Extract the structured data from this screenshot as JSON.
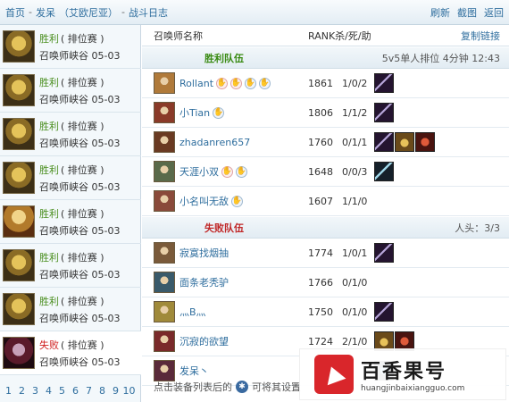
{
  "breadcrumb": {
    "home": "首页",
    "user": "发呆",
    "server": "（艾欧尼亚）",
    "page": "战斗日志"
  },
  "actions": {
    "refresh": "刷新",
    "screenshot": "截图",
    "back": "返回"
  },
  "matches": [
    {
      "result": "胜利",
      "mode": "( 排位赛 )",
      "map": "召唤师峡谷",
      "date": "05-03",
      "avatar": "a"
    },
    {
      "result": "胜利",
      "mode": "( 排位赛 )",
      "map": "召唤师峡谷",
      "date": "05-03",
      "avatar": "a"
    },
    {
      "result": "胜利",
      "mode": "( 排位赛 )",
      "map": "召唤师峡谷",
      "date": "05-03",
      "avatar": "a"
    },
    {
      "result": "胜利",
      "mode": "( 排位赛 )",
      "map": "召唤师峡谷",
      "date": "05-03",
      "avatar": "a"
    },
    {
      "result": "胜利",
      "mode": "( 排位赛 )",
      "map": "召唤师峡谷",
      "date": "05-03",
      "avatar": "alt"
    },
    {
      "result": "胜利",
      "mode": "( 排位赛 )",
      "map": "召唤师峡谷",
      "date": "05-03",
      "avatar": "a"
    },
    {
      "result": "胜利",
      "mode": "( 排位赛 )",
      "map": "召唤师峡谷",
      "date": "05-03",
      "avatar": "a"
    },
    {
      "result": "失败",
      "mode": "( 排位赛 )",
      "map": "召唤师峡谷",
      "date": "05-03",
      "avatar": "lose"
    }
  ],
  "pager": [
    "1",
    "2",
    "3",
    "4",
    "5",
    "6",
    "7",
    "8",
    "9",
    "10"
  ],
  "table": {
    "col_name": "召唤师名称",
    "col_stats": "RANK杀/死/助",
    "copy_link": "复制链接"
  },
  "teams": {
    "win": {
      "name": "胜利队伍",
      "info": "5v5单人排位 4分钟 12:43"
    },
    "lose": {
      "name": "失败队伍",
      "info": "人头：3/3"
    }
  },
  "win_players": [
    {
      "name": "Rollant",
      "rank": "1861",
      "kda": "1/0/2",
      "icons": [
        "red",
        "red",
        "blue",
        "blue"
      ],
      "items": [
        "sword"
      ],
      "champ": "#b07a3a"
    },
    {
      "name": "小Tian",
      "rank": "1806",
      "kda": "1/1/2",
      "icons": [
        "blue"
      ],
      "items": [
        "sword"
      ],
      "champ": "#8a3a28"
    },
    {
      "name": "zhadanren657",
      "rank": "1760",
      "kda": "0/1/1",
      "icons": [],
      "items": [
        "sword",
        "gold",
        "red"
      ],
      "champ": "#6a3a22"
    },
    {
      "name": "天涯小双",
      "rank": "1648",
      "kda": "0/0/3",
      "icons": [
        "red",
        "blue"
      ],
      "items": [
        "blade"
      ],
      "champ": "#5a6a4a"
    },
    {
      "name": "小名叫无敌",
      "rank": "1607",
      "kda": "1/1/0",
      "icons": [
        "blue"
      ],
      "items": [],
      "champ": "#8a4a3a"
    }
  ],
  "lose_players": [
    {
      "name": "寂寞找烟抽",
      "rank": "1774",
      "kda": "1/0/1",
      "icons": [],
      "items": [
        "sword"
      ],
      "champ": "#7a5a3a"
    },
    {
      "name": "面条老秃驴",
      "rank": "1766",
      "kda": "0/1/0",
      "icons": [],
      "items": [],
      "champ": "#3a5a6a"
    },
    {
      "name": "灬B灬",
      "rank": "1750",
      "kda": "0/1/0",
      "icons": [],
      "items": [
        "sword"
      ],
      "champ": "#a08a3a"
    },
    {
      "name": "沉寂的欲望",
      "rank": "1724",
      "kda": "2/1/0",
      "icons": [],
      "items": [
        "gold",
        "red"
      ],
      "champ": "#7a2a2a"
    },
    {
      "name": "发呆丶",
      "rank": "",
      "kda": "",
      "icons": [],
      "items": [
        "blue"
      ],
      "champ": "#5a2a3a"
    }
  ],
  "footer": {
    "text1": "点击装备列表后的",
    "text2": "可将其设置"
  },
  "watermark": {
    "cn": "百香果号",
    "en": "huangjinbaixiangguo.com"
  }
}
